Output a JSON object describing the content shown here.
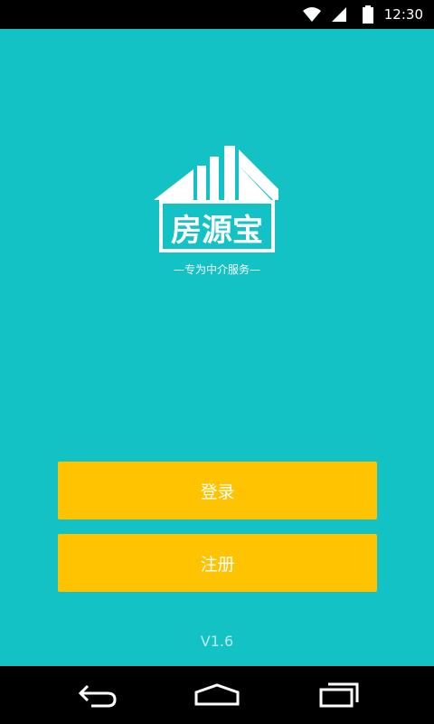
{
  "status_bar": {
    "time": "12:30",
    "icons": [
      "wifi-icon",
      "signal-icon",
      "battery-icon"
    ]
  },
  "app": {
    "logo": {
      "name": "房源宝",
      "slogan": "—专为中介服务—"
    },
    "buttons": {
      "login": "登录",
      "register": "注册"
    },
    "version": "V1.6"
  },
  "navigation_bar": {
    "icons": [
      "back-icon",
      "home-icon",
      "recent-apps-icon"
    ]
  },
  "colors": {
    "background": "#13c2c5",
    "button": "#ffc301",
    "bars": "#000000"
  }
}
